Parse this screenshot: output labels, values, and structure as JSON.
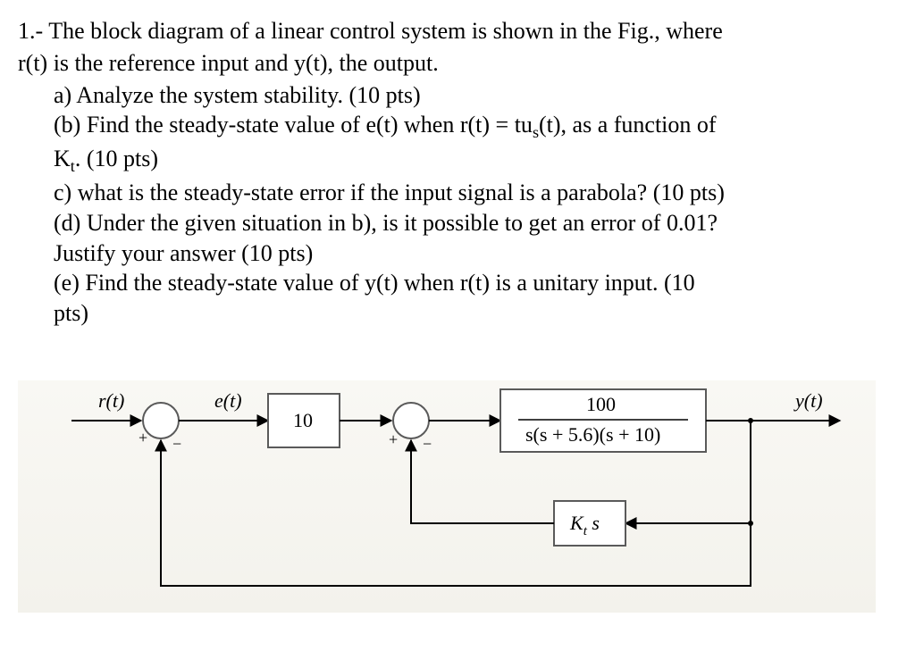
{
  "problem": {
    "number": "1.-",
    "stem_a": "The block diagram of a linear control system is shown in the Fig., where",
    "stem_b": "r(t) is the reference input and y(t), the output.",
    "parts": {
      "a": "a)  Analyze the system stability. (10 pts)",
      "b1": "(b) Find the steady-state value of e(t) when r(t) = tu",
      "b1_sub": "s",
      "b1_tail": "(t), as a function of",
      "b2_pre": "K",
      "b2_sub": "t",
      "b2_tail": ". (10 pts)",
      "c": "c) what is the steady-state error if the input signal is a parabola? (10 pts)",
      "d1": "(d) Under the given situation in b), is it possible to get an error of 0.01?",
      "d2": "Justify your answer (10 pts)",
      "e1": "(e) Find the steady-state value of  y(t) when r(t) is a unitary input. (10",
      "e2": "pts)"
    }
  },
  "diagram": {
    "signals": {
      "r": "r(t)",
      "e": "e(t)",
      "y": "y(t)"
    },
    "blocks": {
      "gain": "10",
      "plant_num": "100",
      "plant_den": "s(s + 5.6)(s + 10)",
      "feedback_pre": "K",
      "feedback_sub": "t",
      "feedback_tail": " s"
    },
    "plus": "+",
    "minus": "−"
  },
  "chart_data": {
    "type": "block-diagram",
    "input": "r(t)",
    "output": "y(t)",
    "error_signal": "e(t)",
    "forward_path": [
      {
        "type": "sum",
        "inputs": [
          "r(t) (+)",
          "y(t) (−)"
        ]
      },
      {
        "type": "gain",
        "value": 10
      },
      {
        "type": "sum",
        "inputs": [
          "(+)",
          "inner_feedback (−)"
        ]
      },
      {
        "type": "transfer_function",
        "numerator": "100",
        "denominator": "s(s + 5.6)(s + 10)"
      }
    ],
    "inner_feedback": {
      "transfer_function": "K_t · s",
      "from": "y(t)",
      "to": "second_sum"
    },
    "outer_feedback": {
      "type": "unity",
      "from": "y(t)",
      "to": "first_sum"
    }
  }
}
